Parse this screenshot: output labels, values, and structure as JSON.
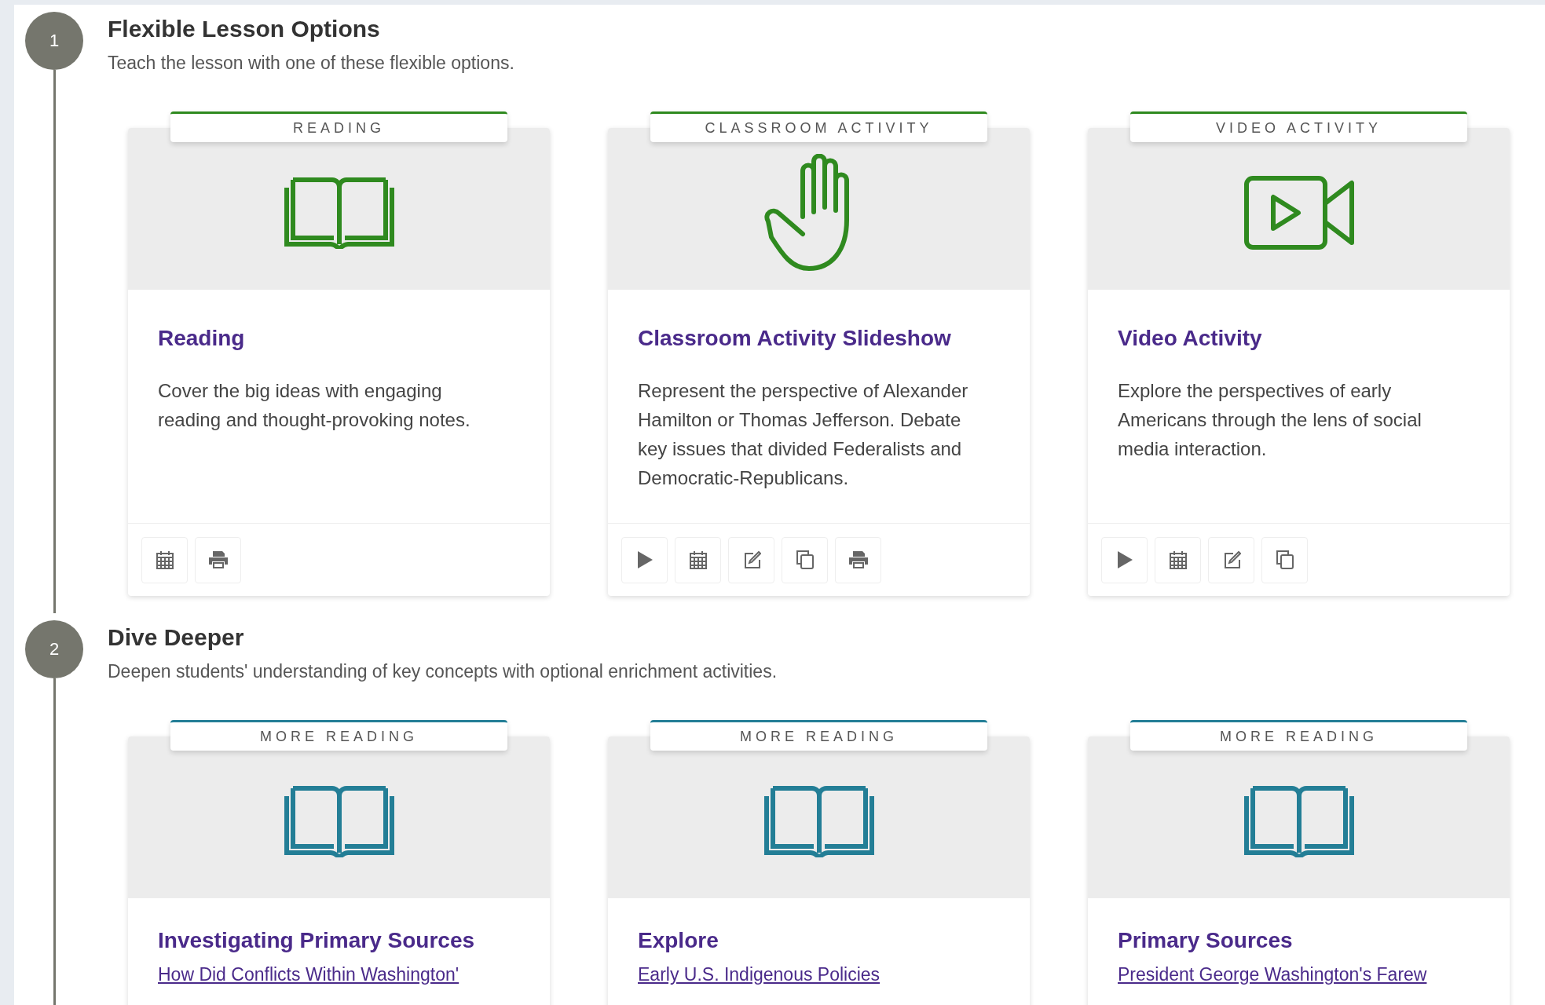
{
  "sections": [
    {
      "number": "1",
      "title": "Flexible Lesson Options",
      "subtitle": "Teach the lesson with one of these flexible options.",
      "color": "#2f8a1f",
      "cards": [
        {
          "label": "READING",
          "kind": "book",
          "title": "Reading",
          "description": "Cover the big ideas with engaging reading and thought-provoking notes.",
          "actions": [
            {
              "kind": "calendar"
            },
            {
              "kind": "print"
            }
          ]
        },
        {
          "label": "CLASSROOM ACTIVITY",
          "kind": "hand",
          "title": "Classroom Activity Slideshow",
          "description": "Represent the perspective of Alexander Hamilton or Thomas Jefferson. Debate key issues that divided Federalists and Democratic-Republicans.",
          "actions": [
            {
              "kind": "play"
            },
            {
              "kind": "calendar"
            },
            {
              "kind": "edit"
            },
            {
              "kind": "copy"
            },
            {
              "kind": "print"
            }
          ]
        },
        {
          "label": "VIDEO ACTIVITY",
          "kind": "video",
          "title": "Video Activity",
          "description": "Explore the perspectives of early Americans through the lens of social media interaction.",
          "actions": [
            {
              "kind": "play"
            },
            {
              "kind": "calendar"
            },
            {
              "kind": "edit"
            },
            {
              "kind": "copy"
            }
          ]
        }
      ]
    },
    {
      "number": "2",
      "title": "Dive Deeper",
      "subtitle": "Deepen students' understanding of key concepts with optional enrichment activities.",
      "color": "#237e96",
      "cards": [
        {
          "label": "MORE READING",
          "kind": "book",
          "title": "Investigating Primary Sources",
          "link": "How Did Conflicts Within Washington'"
        },
        {
          "label": "MORE READING",
          "kind": "book",
          "title": "Explore",
          "link": "Early U.S. Indigenous Policies"
        },
        {
          "label": "MORE READING",
          "kind": "book",
          "title": "Primary Sources",
          "link": "President George Washington's Farew"
        }
      ]
    }
  ]
}
